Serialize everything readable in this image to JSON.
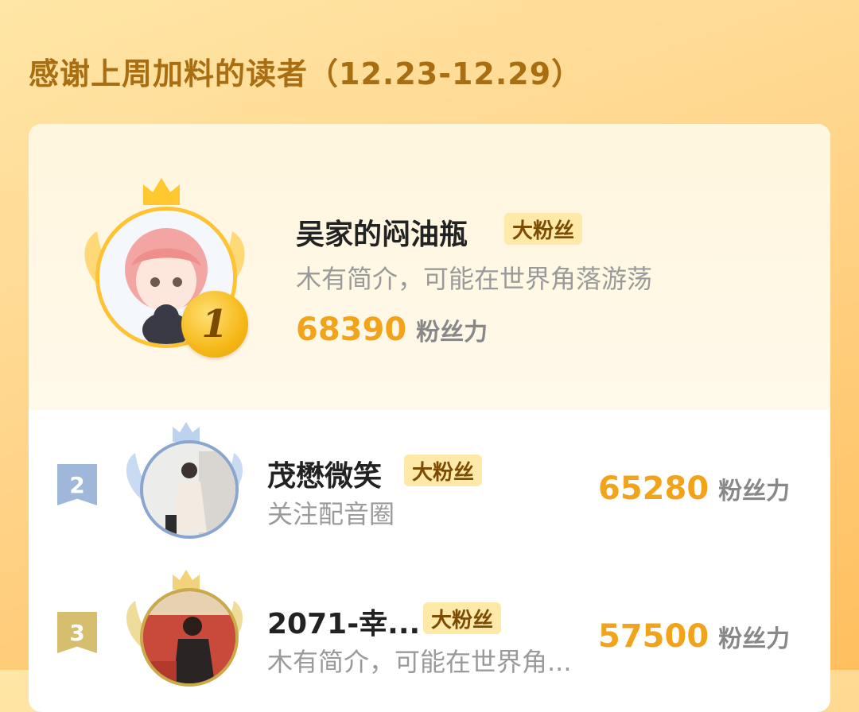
{
  "header": {
    "title": "感谢上周加料的读者（12.23-12.29）"
  },
  "colors": {
    "accent": "#f3a319",
    "title": "#a96d12",
    "badge_bg": "#ffe9a8",
    "rank2": "#9fb7d9",
    "rank3": "#d5bf6f"
  },
  "leaders": [
    {
      "rank": "1",
      "name": "吴家的闷油瓶",
      "badge": "大粉丝",
      "bio": "木有简介，可能在世界角落游荡",
      "score": "68390",
      "score_unit": "粉丝力",
      "icons": [
        "crown-icon",
        "wing-icon",
        "avatar-anime-girl"
      ]
    },
    {
      "rank": "2",
      "name": "茂懋微笑",
      "badge": "大粉丝",
      "bio": "关注配音圈",
      "score": "65280",
      "score_unit": "粉丝力",
      "icons": [
        "crown-icon",
        "wing-icon",
        "avatar-person-photo"
      ]
    },
    {
      "rank": "3",
      "name": "2071-幸...",
      "badge": "大粉丝",
      "bio": "木有简介，可能在世界角...",
      "score": "57500",
      "score_unit": "粉丝力",
      "icons": [
        "crown-icon",
        "wing-icon",
        "avatar-person-photo"
      ]
    }
  ]
}
